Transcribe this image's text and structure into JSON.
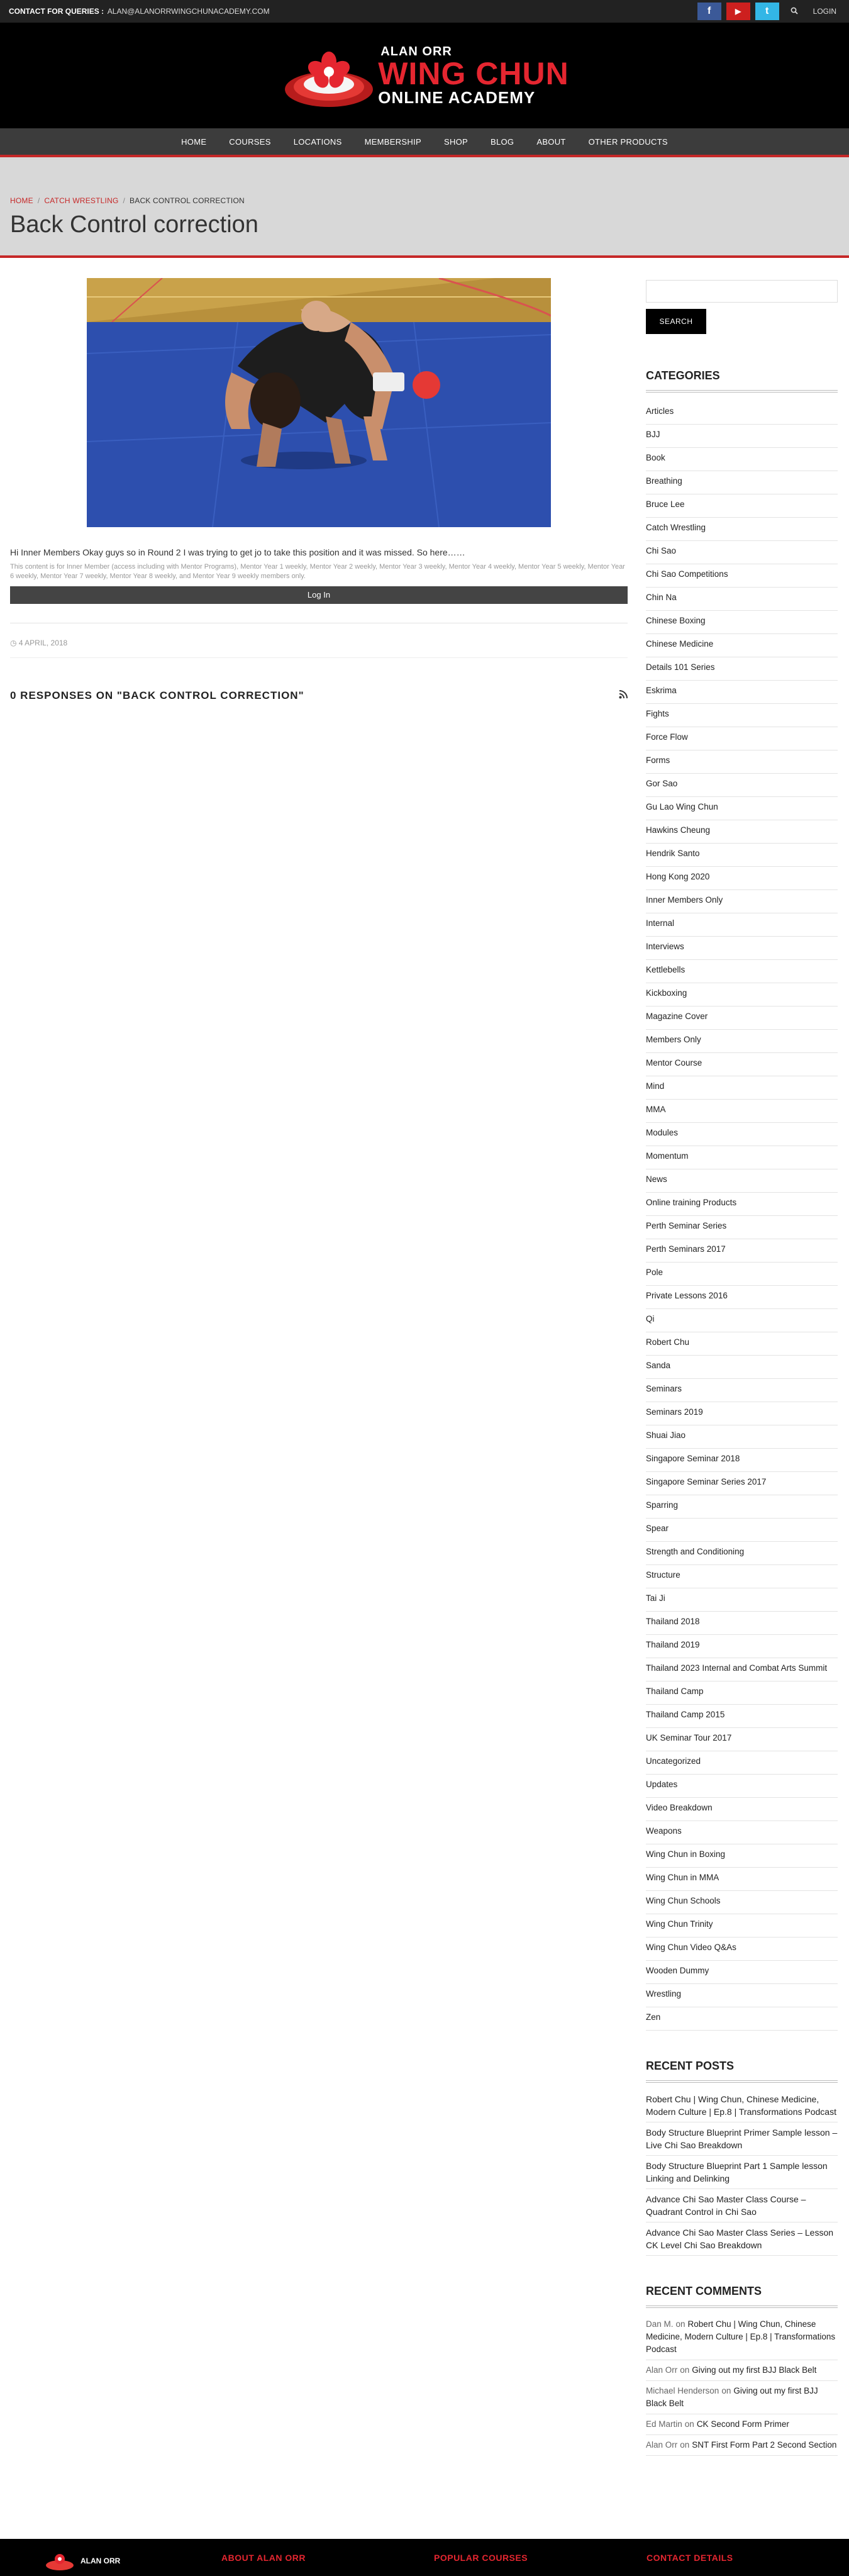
{
  "topbar": {
    "contact_label": "CONTACT FOR QUERIES :",
    "contact_email": "ALAN@ALANORRWINGCHUNACADEMY.COM",
    "social": [
      {
        "name": "facebook",
        "glyph": "f",
        "color": "#3b5998"
      },
      {
        "name": "youtube",
        "glyph": "▶",
        "color": "#cd201f"
      },
      {
        "name": "twitter",
        "glyph": "t",
        "color": "#33b6e6"
      }
    ],
    "search_glyph": "🔍",
    "login_label": "LOGIN"
  },
  "logo": {
    "line1": "ALAN ORR",
    "line2": "WING CHUN",
    "line3": "ONLINE ACADEMY"
  },
  "nav": {
    "items": [
      "HOME",
      "COURSES",
      "LOCATIONS",
      "MEMBERSHIP",
      "SHOP",
      "BLOG",
      "ABOUT",
      "OTHER PRODUCTS"
    ]
  },
  "breadcrumb": {
    "home": "HOME",
    "category": "CATCH WRESTLING",
    "current": "BACK CONTROL CORRECTION"
  },
  "page_title": "Back Control correction",
  "post": {
    "excerpt": "Hi Inner Members Okay guys so in Round 2 I was trying to get jo to take this position and it was missed. So here……",
    "restriction": "This content is for Inner Member (access including with Mentor Programs), Mentor Year 1 weekly, Mentor Year 2 weekly, Mentor Year 3 weekly, Mentor Year 4 weekly, Mentor Year 5 weekly, Mentor Year 6 weekly, Mentor Year 7 weekly, Mentor Year 8 weekly, and Mentor Year 9 weekly members only.",
    "login_button": "Log In",
    "date": "4 APRIL, 2018"
  },
  "responses": {
    "title": "0 RESPONSES ON \"BACK CONTROL CORRECTION\""
  },
  "sidebar": {
    "search_button": "SEARCH",
    "categories_title": "CATEGORIES",
    "categories": [
      "Articles",
      "BJJ",
      "Book",
      "Breathing",
      "Bruce Lee",
      "Catch Wrestling",
      "Chi Sao",
      "Chi Sao Competitions",
      "Chin Na",
      "Chinese Boxing",
      "Chinese Medicine",
      "Details 101 Series",
      "Eskrima",
      "Fights",
      "Force Flow",
      "Forms",
      "Gor Sao",
      "Gu Lao Wing Chun",
      "Hawkins Cheung",
      "Hendrik Santo",
      "Hong Kong 2020",
      "Inner Members Only",
      "Internal",
      "Interviews",
      "Kettlebells",
      "Kickboxing",
      "Magazine Cover",
      "Members Only",
      "Mentor Course",
      "Mind",
      "MMA",
      "Modules",
      "Momentum",
      "News",
      "Online training Products",
      "Perth Seminar Series",
      "Perth Seminars 2017",
      "Pole",
      "Private Lessons 2016",
      "Qi",
      "Robert Chu",
      "Sanda",
      "Seminars",
      "Seminars 2019",
      "Shuai Jiao",
      "Singapore Seminar 2018",
      "Singapore Seminar Series 2017",
      "Sparring",
      "Spear",
      "Strength and Conditioning",
      "Structure",
      "Tai Ji",
      "Thailand 2018",
      "Thailand 2019",
      "Thailand 2023 Internal and Combat Arts Summit",
      "Thailand Camp",
      "Thailand Camp 2015",
      "UK Seminar Tour 2017",
      "Uncategorized",
      "Updates",
      "Video Breakdown",
      "Weapons",
      "Wing Chun in Boxing",
      "Wing Chun in MMA",
      "Wing Chun Schools",
      "Wing Chun Trinity",
      "Wing Chun Video Q&As",
      "Wooden Dummy",
      "Wrestling",
      "Zen"
    ],
    "recent_posts_title": "RECENT POSTS",
    "recent_posts": [
      "Robert Chu | Wing Chun, Chinese Medicine, Modern Culture | Ep.8 | Transformations Podcast",
      "Body Structure Blueprint Primer Sample lesson – Live Chi Sao Breakdown",
      "Body Structure Blueprint Part 1 Sample lesson Linking and Delinking",
      "Advance Chi Sao Master Class Course – Quadrant Control in Chi Sao",
      "Advance Chi Sao Master Class Series – Lesson CK Level Chi Sao Breakdown"
    ],
    "recent_comments_title": "RECENT COMMENTS",
    "recent_comments": [
      {
        "author": "Dan M.",
        "on": "on",
        "post": "Robert Chu | Wing Chun, Chinese Medicine, Modern Culture | Ep.8 | Transformations Podcast"
      },
      {
        "author": "Alan Orr",
        "on": "on",
        "post": "Giving out my first BJJ Black Belt"
      },
      {
        "author": "Michael Henderson",
        "on": "on",
        "post": "Giving out my first BJJ Black Belt"
      },
      {
        "author": "Ed Martin",
        "on": "on",
        "post": "CK Second Form Primer"
      },
      {
        "author": "Alan Orr",
        "on": "on",
        "post": "SNT First Form Part 2 Second Section"
      }
    ]
  },
  "footer": {
    "logo_text": "ALAN ORR",
    "about": "ABOUT ALAN ORR",
    "popular": "POPULAR COURSES",
    "contact": "CONTACT DETAILS"
  },
  "colors": {
    "accent": "#c62828",
    "logo_red": "#e52630",
    "nav_bg": "#3c3c3c"
  }
}
